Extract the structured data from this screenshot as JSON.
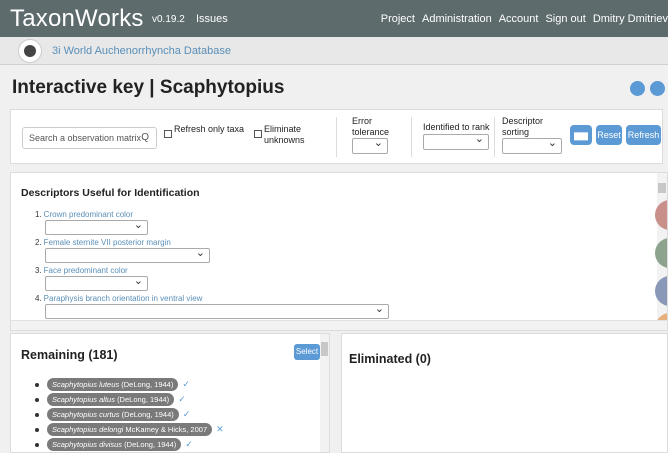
{
  "topbar": {
    "brand": "TaxonWorks",
    "version": "v0.19.2",
    "issues": "Issues",
    "nav": [
      "Project",
      "Administration",
      "Account",
      "Sign out",
      "Dmitry Dmitriev"
    ]
  },
  "project": {
    "name": "3i World Auchenorrhyncha Database"
  },
  "page": {
    "title": "Interactive key | Scaphytopius"
  },
  "controls": {
    "search_placeholder": "Search a observation matrix",
    "refresh_only_taxa": "Refresh only taxa",
    "eliminate_unknowns": "Eliminate unknowns",
    "error_tolerance": "Error tolerance",
    "identified_to_rank": "Identified to rank",
    "descriptor_sorting": "Descriptor sorting",
    "reset": "Reset",
    "refresh": "Refresh"
  },
  "descriptors": {
    "heading": "Descriptors Useful for Identification",
    "items": [
      {
        "num": "1.",
        "label": "Crown predominant color"
      },
      {
        "num": "2.",
        "label": "Female sternite VII posterior margin"
      },
      {
        "num": "3.",
        "label": "Face predominant color"
      },
      {
        "num": "4.",
        "label": "Paraphysis branch orientation in ventral view"
      }
    ]
  },
  "remaining": {
    "heading": "Remaining (181)",
    "select": "Select",
    "taxa": [
      {
        "genus": "Scaphytopius",
        "species": "luteus",
        "author": "(DeLong, 1944)",
        "mark": "✓"
      },
      {
        "genus": "Scaphytopius",
        "species": "altus",
        "author": "(DeLong, 1944)",
        "mark": "✓"
      },
      {
        "genus": "Scaphytopius",
        "species": "curtus",
        "author": "(DeLong, 1944)",
        "mark": "✓"
      },
      {
        "genus": "Scaphytopius",
        "species": "delongi",
        "author": "McKamey & Hicks, 2007",
        "mark": "✕"
      },
      {
        "genus": "Scaphytopius",
        "species": "divisus",
        "author": "(DeLong, 1944)",
        "mark": "✓"
      }
    ]
  },
  "eliminated": {
    "heading": "Eliminated (0)"
  },
  "colors": {
    "topbar": "#5d6b6c",
    "accent": "#5b9ad5",
    "link": "#5a8fb8",
    "pill": "#7a7a7a"
  }
}
